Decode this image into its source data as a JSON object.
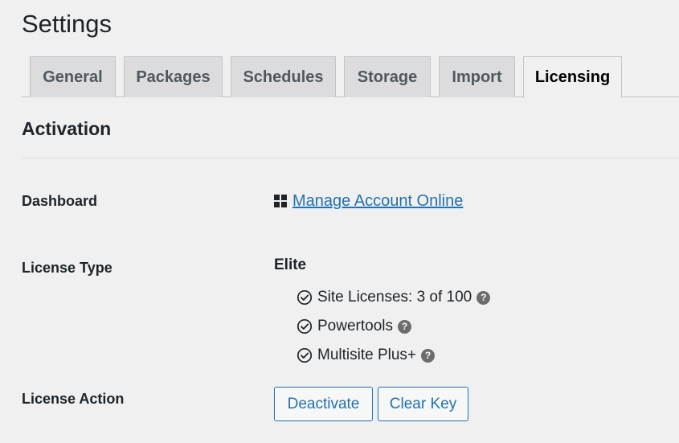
{
  "page": {
    "title": "Settings"
  },
  "tabs": [
    {
      "label": "General"
    },
    {
      "label": "Packages"
    },
    {
      "label": "Schedules"
    },
    {
      "label": "Storage"
    },
    {
      "label": "Import"
    },
    {
      "label": "Licensing",
      "active": true
    }
  ],
  "activation": {
    "section_title": "Activation",
    "dashboard": {
      "label": "Dashboard",
      "icon": "dashboard-grid-icon",
      "link_text": "Manage Account Online"
    },
    "license_type": {
      "label": "License Type",
      "value": "Elite",
      "features": [
        {
          "text": "Site Licenses: 3 of 100",
          "icon": "check-circle-icon",
          "help": "?"
        },
        {
          "text": "Powertools",
          "icon": "check-circle-icon",
          "help": "?"
        },
        {
          "text": "Multisite Plus+",
          "icon": "check-circle-icon",
          "help": "?"
        }
      ]
    },
    "license_action": {
      "label": "License Action",
      "deactivate_label": "Deactivate",
      "clear_key_label": "Clear Key"
    }
  },
  "colors": {
    "background": "#f0f0f1",
    "tab_inactive": "#dcdcde",
    "link": "#2271b1",
    "text": "#1d2327"
  }
}
